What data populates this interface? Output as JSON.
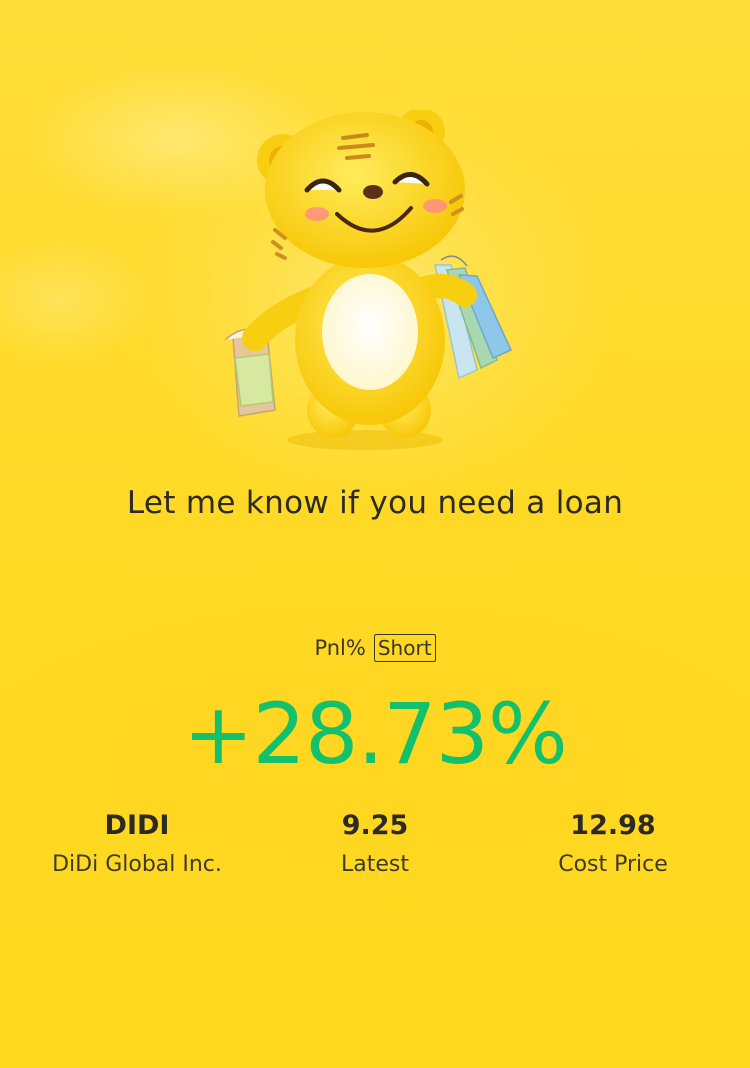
{
  "tagline": "Let me know if you need a loan",
  "pnl": {
    "label": "Pnl%",
    "position_type": "Short",
    "value": "+28.73%",
    "value_color": "#13c16d"
  },
  "stock": {
    "symbol": "DIDI",
    "name": "DiDi Global Inc.",
    "latest_value": "9.25",
    "latest_label": "Latest",
    "cost_value": "12.98",
    "cost_label": "Cost Price"
  },
  "icons": {
    "mascot": "tiger-mascot-with-shopping-bags"
  },
  "colors": {
    "background": "#ffd925",
    "text": "#2c2a24",
    "gain": "#13c16d"
  }
}
